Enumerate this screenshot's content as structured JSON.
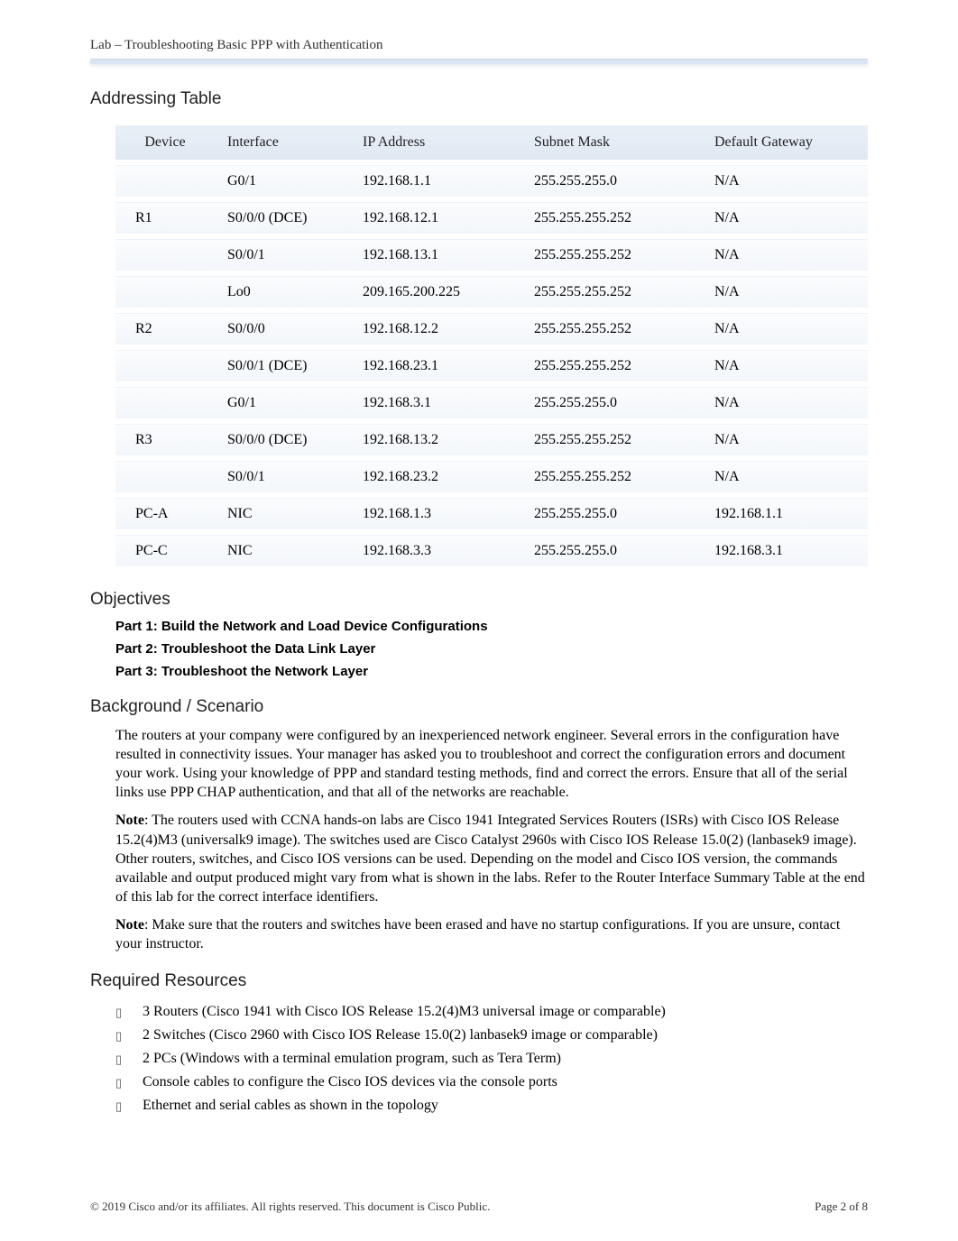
{
  "header": {
    "running": "Lab  – Troubleshooting Basic PPP with Authentication"
  },
  "sections": {
    "addressing": "Addressing Table",
    "objectives": "Objectives",
    "background": "Background / Scenario",
    "resources": "Required Resources"
  },
  "table": {
    "headers": {
      "device": "Device",
      "interface": "Interface",
      "ip": "IP Address",
      "mask": "Subnet Mask",
      "gw": "Default Gateway"
    },
    "rows": [
      {
        "device": "",
        "interface": "G0/1",
        "ip": "192.168.1.1",
        "mask": "255.255.255.0",
        "gw": "N/A"
      },
      {
        "device": "R1",
        "interface": "S0/0/0 (DCE)",
        "ip": "192.168.12.1",
        "mask": "255.255.255.252",
        "gw": "N/A"
      },
      {
        "device": "",
        "interface": "S0/0/1",
        "ip": "192.168.13.1",
        "mask": "255.255.255.252",
        "gw": "N/A"
      },
      {
        "device": "",
        "interface": "Lo0",
        "ip": "209.165.200.225",
        "mask": "255.255.255.252",
        "gw": "N/A"
      },
      {
        "device": "R2",
        "interface": "S0/0/0",
        "ip": "192.168.12.2",
        "mask": "255.255.255.252",
        "gw": "N/A"
      },
      {
        "device": "",
        "interface": "S0/0/1 (DCE)",
        "ip": "192.168.23.1",
        "mask": "255.255.255.252",
        "gw": "N/A"
      },
      {
        "device": "",
        "interface": "G0/1",
        "ip": "192.168.3.1",
        "mask": "255.255.255.0",
        "gw": "N/A"
      },
      {
        "device": "R3",
        "interface": "S0/0/0 (DCE)",
        "ip": "192.168.13.2",
        "mask": "255.255.255.252",
        "gw": "N/A"
      },
      {
        "device": "",
        "interface": "S0/0/1",
        "ip": "192.168.23.2",
        "mask": "255.255.255.252",
        "gw": "N/A"
      },
      {
        "device": "PC-A",
        "interface": "NIC",
        "ip": "192.168.1.3",
        "mask": "255.255.255.0",
        "gw": "192.168.1.1"
      },
      {
        "device": "PC-C",
        "interface": "NIC",
        "ip": "192.168.3.3",
        "mask": "255.255.255.0",
        "gw": "192.168.3.1"
      }
    ]
  },
  "objectives": {
    "part1": "Part 1: Build the Network and Load Device Configurations",
    "part2": "Part 2: Troubleshoot the Data Link Layer",
    "part3": "Part 3: Troubleshoot the Network Layer"
  },
  "background": {
    "p1": "The routers at your company were configured by an inexperienced network engineer. Several errors in the configuration have resulted in connectivity issues. Your manager has asked you to troubleshoot and correct the configuration errors and document your work. Using your knowledge of PPP and standard testing methods, find and correct the errors. Ensure that all of the serial links use PPP CHAP authentication, and that all of the networks are reachable.",
    "note1_label": "Note",
    "note1": ": The routers used with CCNA hands-on labs are Cisco 1941 Integrated Services Routers (ISRs) with Cisco IOS Release 15.2(4)M3 (universalk9 image). The switches used are Cisco Catalyst 2960s with Cisco IOS Release 15.0(2) (lanbasek9 image). Other routers, switches, and Cisco IOS versions can be used. Depending on the model and Cisco IOS version, the commands available and output produced might vary from what is shown in the labs. Refer to the Router Interface Summary Table at the end of this lab for the correct interface identifiers.",
    "note2_label": "Note",
    "note2": ": Make sure that the routers and switches have been erased and have no startup configurations. If you are unsure, contact your instructor."
  },
  "resources": {
    "items": [
      "3 Routers (Cisco 1941 with Cisco IOS Release 15.2(4)M3 universal image or comparable)",
      "2 Switches (Cisco 2960 with Cisco IOS Release 15.0(2) lanbasek9 image or comparable)",
      "2 PCs (Windows with a terminal emulation program, such as Tera Term)",
      "Console cables to configure the Cisco IOS devices via the console ports",
      "Ethernet and serial cables as shown in the topology"
    ]
  },
  "footer": {
    "copyright": "© 2019 Cisco and/or its affiliates. All rights reserved. This document is Cisco Public.",
    "page": "Page  2 of 8"
  }
}
